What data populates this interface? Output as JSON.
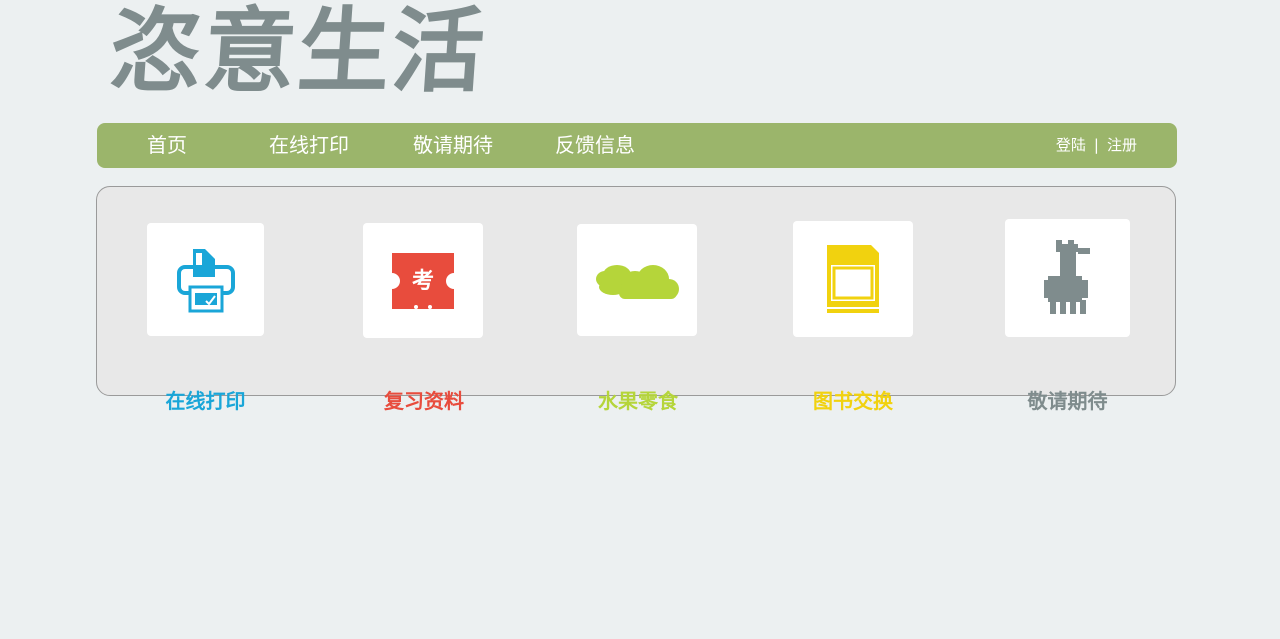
{
  "logo": {
    "text": "恣意生活"
  },
  "nav": {
    "items": [
      {
        "label": "首页"
      },
      {
        "label": "在线打印"
      },
      {
        "label": "敬请期待"
      },
      {
        "label": "反馈信息"
      }
    ],
    "login_label": "登陆",
    "separator": "|",
    "register_label": "注册"
  },
  "features": [
    {
      "label": "在线打印",
      "icon": "printer-icon",
      "color": "#1aa6d8"
    },
    {
      "label": "复习资料",
      "icon": "exam-ticket-icon",
      "color": "#e84c3d"
    },
    {
      "label": "水果零食",
      "icon": "cloud-icon",
      "color": "#b5d53a"
    },
    {
      "label": "图书交换",
      "icon": "book-icon",
      "color": "#f1d20f"
    },
    {
      "label": "敬请期待",
      "icon": "alpaca-icon",
      "color": "#7f8c8d"
    }
  ],
  "colors": {
    "background": "#ecf0f1",
    "navbar": "#9bb56b",
    "logo": "#7f8c8d"
  }
}
